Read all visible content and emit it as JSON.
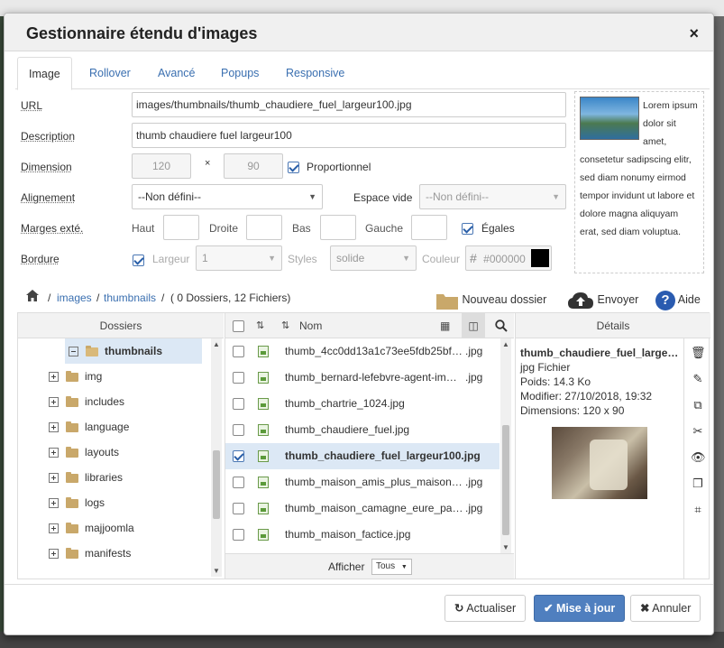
{
  "dialog": {
    "title": "Gestionnaire étendu d'images",
    "close_glyph": "×"
  },
  "tabs": [
    "Image",
    "Rollover",
    "Avancé",
    "Popups",
    "Responsive"
  ],
  "form": {
    "url_label": "URL",
    "url_value": "images/thumbnails/thumb_chaudiere_fuel_largeur100.jpg",
    "description_label": "Description",
    "description_value": "thumb chaudiere fuel largeur100",
    "dimension_label": "Dimension",
    "width_value": "120",
    "times_glyph": "×",
    "height_value": "90",
    "proportional_label": "Proportionnel",
    "alignment_label": "Alignement",
    "alignment_value": "--Non défini--",
    "space_label": "Espace vide",
    "space_value": "--Non défini--",
    "margins_label": "Marges exté.",
    "margin_top_label": "Haut",
    "margin_right_label": "Droite",
    "margin_bottom_label": "Bas",
    "margin_left_label": "Gauche",
    "equal_label": "Égales",
    "border_label": "Bordure",
    "border_width_label": "Largeur",
    "border_width_value": "1",
    "border_style_label": "Styles",
    "border_style_value": "solide",
    "border_color_label": "Couleur",
    "hash_glyph": "#",
    "border_color_value": "#000000",
    "border_color_swatch": "#000000"
  },
  "preview": {
    "text": "Lorem ipsum dolor sit amet, consetetur sadipscing elitr, sed diam nonumy eirmod tempor invidunt ut labore et dolore magna aliquyam erat, sed diam voluptua."
  },
  "breadcrumb": {
    "sep": "/",
    "items": [
      "images",
      "thumbnails"
    ],
    "summary": "( 0 Dossiers, 12 Fichiers)"
  },
  "toolbar": {
    "new_folder": "Nouveau dossier",
    "upload": "Envoyer",
    "help": "Aide"
  },
  "tree": {
    "header": "Dossiers",
    "current": "thumbnails",
    "items": [
      "img",
      "includes",
      "language",
      "layouts",
      "libraries",
      "logs",
      "majjoomla",
      "manifests"
    ]
  },
  "files": {
    "header_name": "Nom",
    "rows": [
      {
        "name": "thumb_4cc0dd13a1c73ee5fdb25bf…",
        "ext": ".jpg",
        "selected": false
      },
      {
        "name": "thumb_bernard-lefebvre-agent-im…",
        "ext": ".jpg",
        "selected": false
      },
      {
        "name": "thumb_chartrie_1024.jpg",
        "ext": "",
        "selected": false
      },
      {
        "name": "thumb_chaudiere_fuel.jpg",
        "ext": "",
        "selected": false
      },
      {
        "name": "thumb_chaudiere_fuel_largeur100.jpg",
        "ext": "",
        "selected": true
      },
      {
        "name": "thumb_maison_amis_plus_maison…",
        "ext": ".jpg",
        "selected": false
      },
      {
        "name": "thumb_maison_camagne_eure_pa…",
        "ext": ".jpg",
        "selected": false
      },
      {
        "name": "thumb_maison_factice.jpg",
        "ext": "",
        "selected": false
      }
    ],
    "show_label": "Afficher",
    "show_value": "Tous"
  },
  "details": {
    "header": "Détails",
    "name": "thumb_chaudiere_fuel_large…",
    "type": "jpg Fichier",
    "size": "Poids: 14.3 Ko",
    "modified": "Modifier: 27/10/2018, 19:32",
    "dimensions": "Dimensions: 120 x 90"
  },
  "footer": {
    "refresh": "Actualiser",
    "update": "Mise à jour",
    "cancel": "Annuler"
  },
  "colors": {
    "link": "#3a6fb0",
    "primary_button": "#4f7fbf",
    "selection": "#dce8f5"
  }
}
